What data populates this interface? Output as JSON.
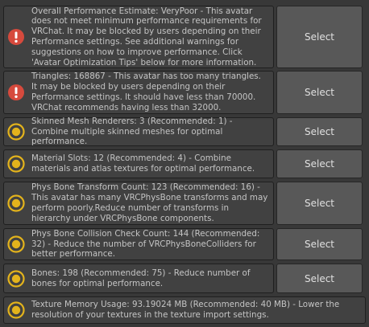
{
  "button_label": "Select",
  "colors": {
    "error": "#d64a3d",
    "warning": "#e3b31c",
    "background": "#383838",
    "message_bg": "#414141",
    "button_bg": "#585858"
  },
  "items": [
    {
      "severity": "error",
      "icon": "error-icon",
      "text": "Overall Performance Estimate: VeryPoor - This avatar does not meet minimum performance requirements for VRChat. It may be blocked by users depending on their Performance settings. See additional warnings for suggestions on how to improve performance. Click 'Avatar Optimization Tips' below for more information."
    },
    {
      "severity": "error",
      "icon": "error-icon",
      "text": "Triangles: 168867 - This avatar has too many triangles. It may be blocked by users depending on their Performance settings. It should have less than 70000. VRChat recommends having less than 32000."
    },
    {
      "severity": "warning",
      "icon": "warning-icon",
      "text": "Skinned Mesh Renderers: 3 (Recommended: 1) - Combine multiple skinned meshes for optimal performance."
    },
    {
      "severity": "warning",
      "icon": "warning-icon",
      "text": "Material Slots: 12 (Recommended: 4) - Combine materials and atlas textures for optimal performance."
    },
    {
      "severity": "warning",
      "icon": "warning-icon",
      "text": "Phys Bone Transform Count: 123 (Recommended: 16) - This avatar has many VRCPhysBone transforms and may perform poorly.Reduce number of transforms in hierarchy under VRCPhysBone components."
    },
    {
      "severity": "warning",
      "icon": "warning-icon",
      "text": "Phys Bone Collision Check Count: 144 (Recommended: 32) - Reduce the number of VRCPhysBoneColliders for better performance."
    },
    {
      "severity": "warning",
      "icon": "warning-icon",
      "text": "Bones: 198 (Recommended: 75) - Reduce number of bones for optimal performance."
    },
    {
      "severity": "warning",
      "icon": "warning-icon",
      "text": "Texture Memory Usage: 93.19024 MB (Recommended: 40 MB) - Lower the resolution of your textures in the texture import settings."
    }
  ]
}
